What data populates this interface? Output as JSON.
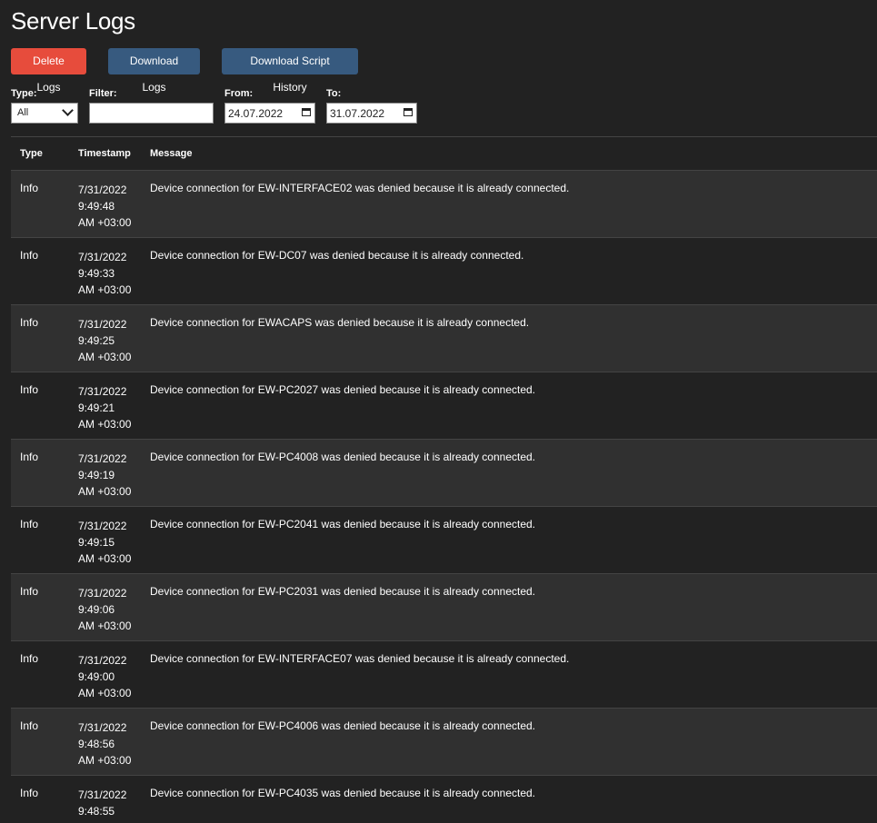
{
  "title": "Server Logs",
  "buttons": {
    "delete": "Delete Logs",
    "download": "Download Logs",
    "download_script": "Download Script History"
  },
  "filters": {
    "type_label": "Type:",
    "type_value": "All",
    "filter_label": "Filter:",
    "filter_value": "",
    "from_label": "From:",
    "from_value": "24.07.2022",
    "to_label": "To:",
    "to_value": "31.07.2022"
  },
  "table": {
    "headers": {
      "type": "Type",
      "timestamp": "Timestamp",
      "message": "Message"
    },
    "rows": [
      {
        "type": "Info",
        "date": "7/31/2022",
        "time": "9:49:48",
        "tz": "AM +03:00",
        "message": "Device connection for EW-INTERFACE02 was denied because it is already connected."
      },
      {
        "type": "Info",
        "date": "7/31/2022",
        "time": "9:49:33",
        "tz": "AM +03:00",
        "message": "Device connection for EW-DC07 was denied because it is already connected."
      },
      {
        "type": "Info",
        "date": "7/31/2022",
        "time": "9:49:25",
        "tz": "AM +03:00",
        "message": "Device connection for EWACAPS was denied because it is already connected."
      },
      {
        "type": "Info",
        "date": "7/31/2022",
        "time": "9:49:21",
        "tz": "AM +03:00",
        "message": "Device connection for EW-PC2027 was denied because it is already connected."
      },
      {
        "type": "Info",
        "date": "7/31/2022",
        "time": "9:49:19",
        "tz": "AM +03:00",
        "message": "Device connection for EW-PC4008 was denied because it is already connected."
      },
      {
        "type": "Info",
        "date": "7/31/2022",
        "time": "9:49:15",
        "tz": "AM +03:00",
        "message": "Device connection for EW-PC2041 was denied because it is already connected."
      },
      {
        "type": "Info",
        "date": "7/31/2022",
        "time": "9:49:06",
        "tz": "AM +03:00",
        "message": "Device connection for EW-PC2031 was denied because it is already connected."
      },
      {
        "type": "Info",
        "date": "7/31/2022",
        "time": "9:49:00",
        "tz": "AM +03:00",
        "message": "Device connection for EW-INTERFACE07 was denied because it is already connected."
      },
      {
        "type": "Info",
        "date": "7/31/2022",
        "time": "9:48:56",
        "tz": "AM +03:00",
        "message": "Device connection for EW-PC4006 was denied because it is already connected."
      },
      {
        "type": "Info",
        "date": "7/31/2022",
        "time": "9:48:55",
        "tz": "",
        "message": "Device connection for EW-PC4035 was denied because it is already connected."
      }
    ]
  },
  "icons": {
    "type_select": "chevron-down-icon",
    "date_picker": "calendar-icon"
  },
  "colors": {
    "background": "#222222",
    "row_alt": "#303030",
    "danger": "#e74c3c",
    "primary": "#375a7f"
  }
}
